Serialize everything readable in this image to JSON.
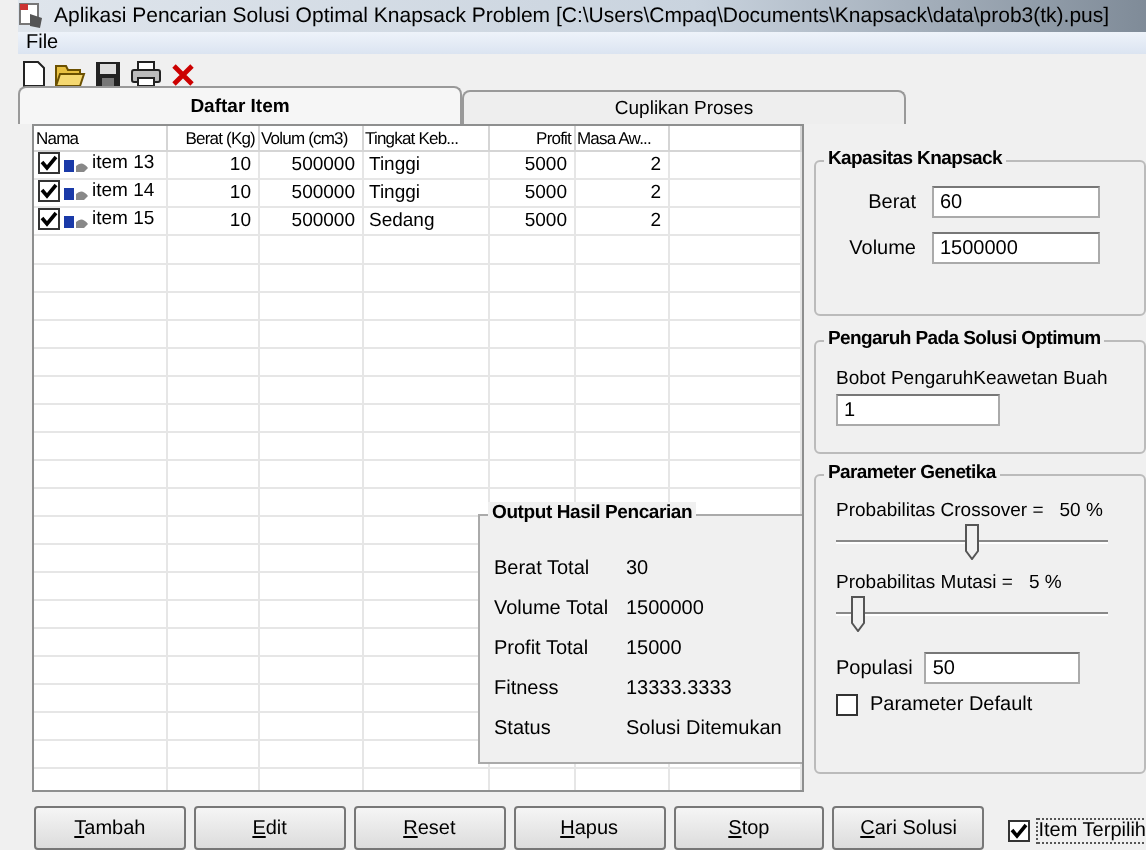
{
  "window": {
    "title": "Aplikasi Pencarian Solusi Optimal Knapsack Problem [C:\\Users\\Cmpaq\\Documents\\Knapsack\\data\\prob3(tk).pus]"
  },
  "menu": [
    {
      "label": "File"
    }
  ],
  "tabs": [
    {
      "label": "Daftar Item",
      "selected": true
    },
    {
      "label": "Cuplikan Proses",
      "selected": false
    }
  ],
  "table": {
    "columns": [
      "Nama",
      "Berat (Kg)",
      "Volum (cm3)",
      "Tingkat Keb...",
      "Profit",
      "Masa Aw..."
    ],
    "rows": [
      {
        "checked": true,
        "cells": [
          "item 13",
          "10",
          "500000",
          "Tinggi",
          "5000",
          "2"
        ]
      },
      {
        "checked": true,
        "cells": [
          "item 14",
          "10",
          "500000",
          "Tinggi",
          "5000",
          "2"
        ]
      },
      {
        "checked": true,
        "cells": [
          "item 15",
          "10",
          "500000",
          "Sedang",
          "5000",
          "2"
        ]
      }
    ]
  },
  "output": {
    "title": "Output Hasil Pencarian",
    "rows": [
      {
        "label": "Berat Total",
        "value": "30"
      },
      {
        "label": "Volume Total",
        "value": "1500000"
      },
      {
        "label": "Profit Total",
        "value": "15000"
      },
      {
        "label": "Fitness",
        "value": "13333.3333"
      },
      {
        "label": "Status",
        "value": "Solusi Ditemukan"
      }
    ]
  },
  "capacity": {
    "title": "Kapasitas Knapsack",
    "fields": [
      {
        "label": "Berat",
        "value": "60"
      },
      {
        "label": "Volume",
        "value": "1500000"
      }
    ]
  },
  "influence": {
    "title": "Pengaruh Pada Solusi Optimum",
    "label": "Bobot PengaruhKeawetan Buah",
    "value": "1"
  },
  "genetics": {
    "title": "Parameter Genetika",
    "sliders": [
      {
        "label": "Probabilitas Crossover =",
        "reading": "50 %",
        "level": 0.5
      },
      {
        "label": "Probabilitas Mutasi =",
        "reading": "5 %",
        "level": 0.08
      }
    ],
    "population": {
      "label": "Populasi",
      "value": "50"
    },
    "default_checkbox": {
      "label": "Parameter Default",
      "checked": false
    }
  },
  "buttons": [
    "Tambah",
    "Edit",
    "Reset",
    "Hapus",
    "Stop",
    "Cari Solusi"
  ],
  "selected_items_checkbox": {
    "label": "Item Terpilih",
    "checked": true
  }
}
